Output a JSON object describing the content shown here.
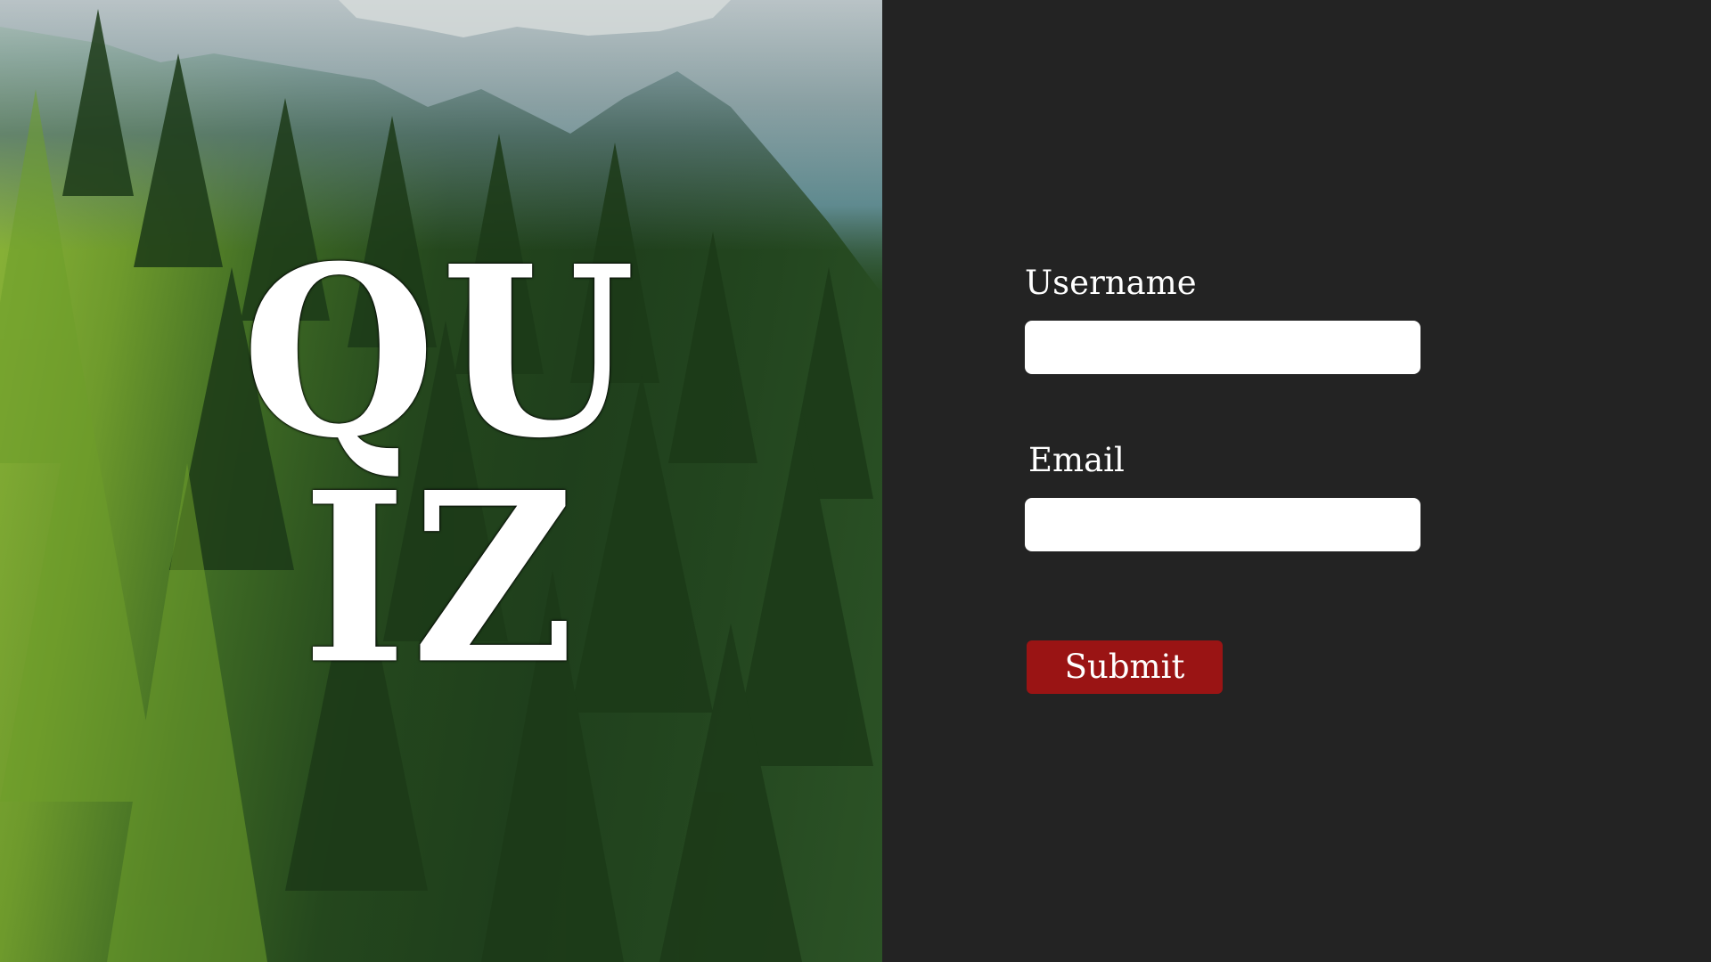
{
  "hero": {
    "title_line1": "QU",
    "title_line2": "IZ"
  },
  "form": {
    "username_label": "Username",
    "username_value": "",
    "email_label": "Email",
    "email_value": "",
    "submit_label": "Submit"
  },
  "colors": {
    "background": "#232323",
    "submit_button": "#9a1414",
    "field_background": "#ffffff",
    "text": "#ffffff"
  }
}
